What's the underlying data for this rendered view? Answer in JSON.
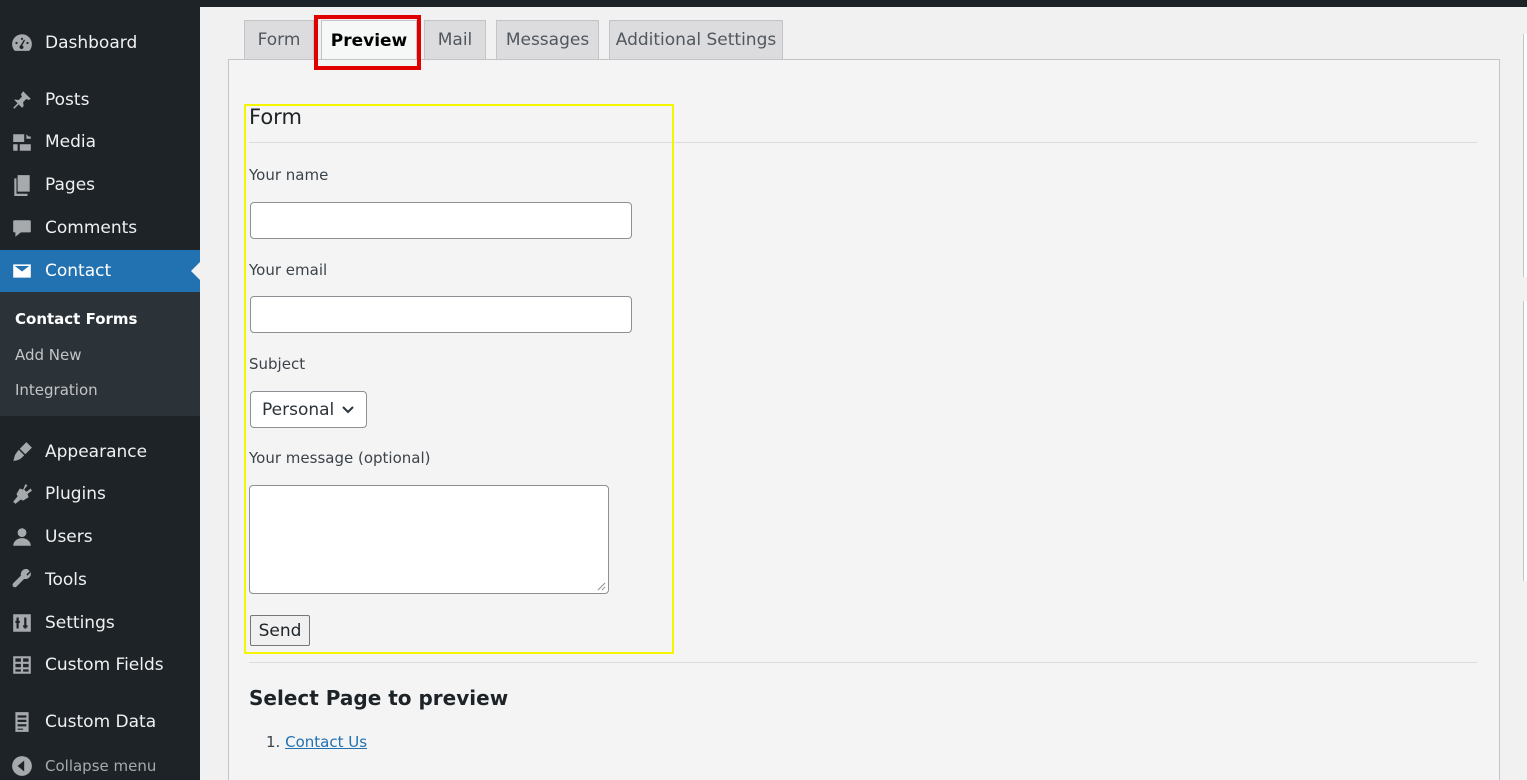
{
  "sidebar": {
    "menu": [
      {
        "label": "Dashboard",
        "icon": "dashboard-icon"
      },
      {
        "label": "Posts",
        "icon": "pushpin-icon"
      },
      {
        "label": "Media",
        "icon": "media-icon"
      },
      {
        "label": "Pages",
        "icon": "pages-icon"
      },
      {
        "label": "Comments",
        "icon": "comment-icon"
      },
      {
        "label": "Contact",
        "icon": "envelope-icon",
        "active": true
      },
      {
        "label": "Appearance",
        "icon": "paintbrush-icon"
      },
      {
        "label": "Plugins",
        "icon": "plugin-icon"
      },
      {
        "label": "Users",
        "icon": "user-icon"
      },
      {
        "label": "Tools",
        "icon": "wrench-icon"
      },
      {
        "label": "Settings",
        "icon": "settings-sliders-icon"
      },
      {
        "label": "Custom Fields",
        "icon": "table-icon"
      },
      {
        "label": "Custom Data",
        "icon": "document-icon"
      }
    ],
    "submenu": [
      "Contact Forms",
      "Add New",
      "Integration"
    ],
    "collapse_label": "Collapse menu"
  },
  "tabs": [
    "Form",
    "Preview",
    "Mail",
    "Messages",
    "Additional Settings"
  ],
  "active_tab": "Preview",
  "preview": {
    "form_title": "Form",
    "fields": {
      "name_label": "Your name",
      "email_label": "Your email",
      "subject_label": "Subject",
      "subject_value": "Personal",
      "message_label": "Your message (optional)"
    },
    "send_label": "Send",
    "select_page_title": "Select Page to preview",
    "page_list_number": "1.",
    "pages": [
      "Contact Us"
    ]
  },
  "colors": {
    "sidebar_bg": "#1d2327",
    "active_blue": "#2271b1",
    "highlight_red": "#e00000",
    "highlight_yellow": "#f5f500"
  }
}
